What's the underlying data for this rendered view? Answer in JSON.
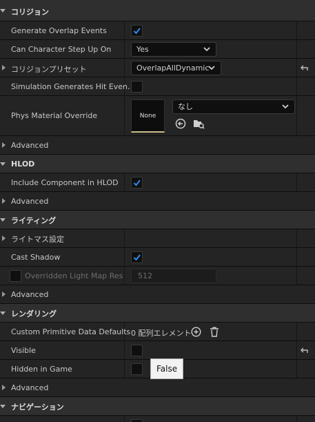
{
  "categories": {
    "collision": "コリジョン",
    "hlod": "HLOD",
    "lighting": "ライティング",
    "rendering": "レンダリング",
    "navigation": "ナビゲーション"
  },
  "collision": {
    "generate_overlap_label": "Generate Overlap Events",
    "generate_overlap_checked": true,
    "step_up_label": "Can Character Step Up On",
    "step_up_value": "Yes",
    "preset_label": "コリジョンプリセット",
    "preset_value": "OverlapAllDynamic",
    "sim_hit_label": "Simulation Generates Hit Even…",
    "sim_hit_checked": false,
    "phys_label": "Phys Material Override",
    "phys_thumb_text": "None",
    "phys_value": "なし",
    "advanced": "Advanced"
  },
  "hlod": {
    "include_label": "Include Component in HLOD",
    "include_checked": true,
    "advanced": "Advanced"
  },
  "lighting": {
    "lightmass_label": "ライトマス設定",
    "cast_shadow_label": "Cast Shadow",
    "cast_shadow_checked": true,
    "overridden_label": "Overridden Light Map Res",
    "overridden_value": "512",
    "advanced": "Advanced"
  },
  "rendering": {
    "custom_prim_label": "Custom Primitive Data Defaults",
    "custom_prim_value": "0 配列エレメント",
    "visible_label": "Visible",
    "hidden_label": "Hidden in Game",
    "tooltip": "False",
    "advanced": "Advanced"
  },
  "colors": {
    "accent": "#2f8cf0",
    "background": "#151515",
    "row": "#242424",
    "category": "#2f2f2f"
  },
  "icons": [
    "chevron-down-icon",
    "chevron-right-icon",
    "checkmark-icon",
    "reset-arrow-icon",
    "browse-back-icon",
    "browse-folder-icon",
    "plus-icon",
    "trash-icon"
  ]
}
